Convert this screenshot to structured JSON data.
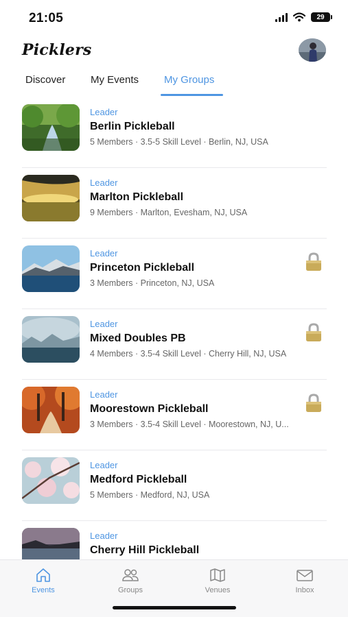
{
  "status_bar": {
    "time": "21:05",
    "battery": "29"
  },
  "header": {
    "brand": "Picklers"
  },
  "tabs": [
    {
      "label": "Discover",
      "active": false
    },
    {
      "label": "My Events",
      "active": false
    },
    {
      "label": "My Groups",
      "active": true
    }
  ],
  "groups": [
    {
      "role": "Leader",
      "name": "Berlin Pickleball",
      "meta": "5 Members · 3.5-5 Skill Level · Berlin, NJ, USA",
      "locked": false,
      "thumb": "forest-stream"
    },
    {
      "role": "Leader",
      "name": "Marlton Pickleball",
      "meta": "9 Members · Marlton, Evesham, NJ, USA",
      "locked": false,
      "thumb": "golden-field"
    },
    {
      "role": "Leader",
      "name": "Princeton Pickleball",
      "meta": "3 Members · Princeton, NJ, USA",
      "locked": true,
      "thumb": "mountain-lake"
    },
    {
      "role": "Leader",
      "name": "Mixed Doubles PB",
      "meta": "4 Members · 3.5-4 Skill Level · Cherry Hill, NJ, USA",
      "locked": true,
      "thumb": "misty-lake"
    },
    {
      "role": "Leader",
      "name": "Moorestown Pickleball",
      "meta": "3 Members · 3.5-4 Skill Level · Moorestown, NJ, U...",
      "locked": true,
      "thumb": "autumn-path"
    },
    {
      "role": "Leader",
      "name": "Medford Pickleball",
      "meta": "5 Members · Medford, NJ, USA",
      "locked": false,
      "thumb": "cherry-blossom"
    },
    {
      "role": "Leader",
      "name": "Cherry Hill Pickleball",
      "meta": "",
      "locked": false,
      "thumb": "dusk-shore"
    }
  ],
  "bottom_nav": [
    {
      "label": "Events",
      "icon": "home-icon",
      "active": true
    },
    {
      "label": "Groups",
      "icon": "people-icon",
      "active": false
    },
    {
      "label": "Venues",
      "icon": "map-icon",
      "active": false
    },
    {
      "label": "Inbox",
      "icon": "mail-icon",
      "active": false
    }
  ],
  "colors": {
    "accent": "#4e95e2",
    "lock": "#c9ab5a"
  }
}
